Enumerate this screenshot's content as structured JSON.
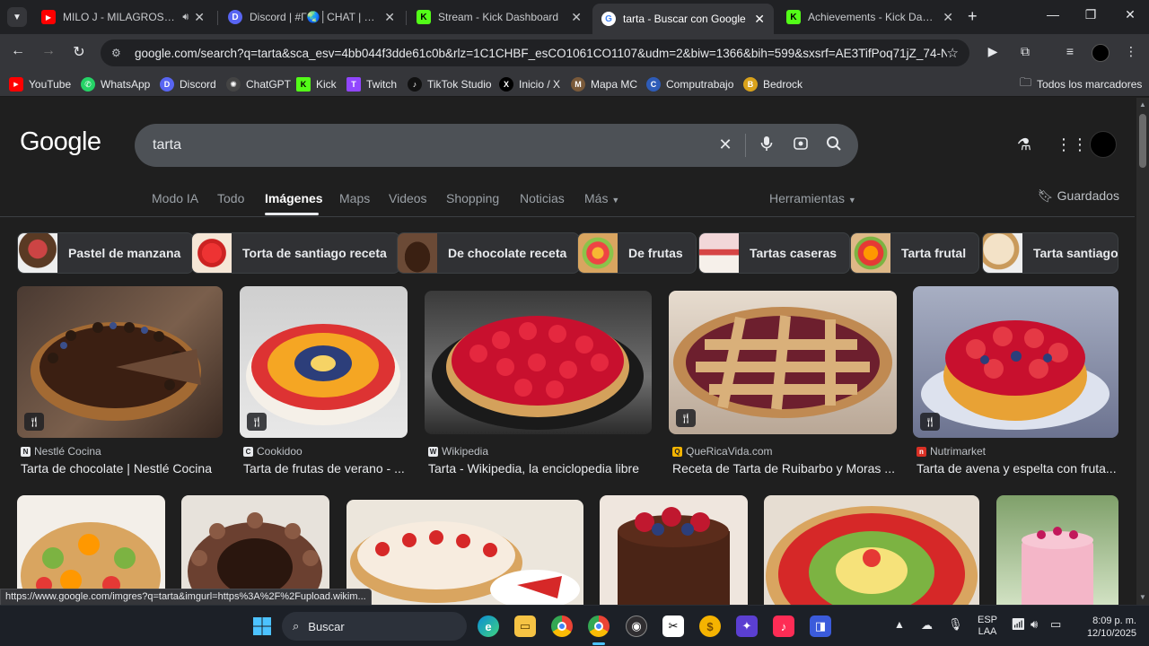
{
  "tabs": [
    {
      "label": "MILO J - MILAGROSA (V",
      "favicon_color": "#ff0000",
      "favicon_glyph": "▶",
      "icon": "youtube-icon",
      "audio": true
    },
    {
      "label": "Discord | #Γ🌏│CHAT | CATADO",
      "favicon_color": "#5865f2",
      "favicon_glyph": "D",
      "icon": "discord-icon"
    },
    {
      "label": "Stream - Kick Dashboard",
      "favicon_color": "#53fc18",
      "favicon_glyph": "K",
      "icon": "kick-icon"
    },
    {
      "label": "tarta - Buscar con Google",
      "favicon_color": "#ffffff",
      "favicon_glyph": "G",
      "icon": "google-icon",
      "active": true
    },
    {
      "label": "Achievements - Kick Dashbo",
      "favicon_color": "#53fc18",
      "favicon_glyph": "K",
      "icon": "kick-icon"
    }
  ],
  "toolbar": {
    "url": "google.com/search?q=tarta&sca_esv=4bb044f3dde61c0b&rlz=1C1CHBF_esCO1061CO1107&udm=2&biw=1366&bih=599&sxsrf=AE3TifPoq71jZ_74-NU..."
  },
  "bookmarks": [
    {
      "label": "YouTube",
      "color": "#ff0000",
      "glyph": "▶"
    },
    {
      "label": "WhatsApp",
      "color": "#25d366",
      "glyph": "✆"
    },
    {
      "label": "Discord",
      "color": "#5865f2",
      "glyph": "D"
    },
    {
      "label": "ChatGPT",
      "color": "#444",
      "glyph": "✺"
    },
    {
      "label": "Kick",
      "color": "#53fc18",
      "glyph": "K"
    },
    {
      "label": "Twitch",
      "color": "#9146ff",
      "glyph": "T"
    },
    {
      "label": "TikTok Studio",
      "color": "#111",
      "glyph": "♪"
    },
    {
      "label": "Inicio / X",
      "color": "#000",
      "glyph": "X"
    },
    {
      "label": "Mapa MC",
      "color": "#7a5a3a",
      "glyph": "M"
    },
    {
      "label": "Computrabajo",
      "color": "#2e5cb8",
      "glyph": "C"
    },
    {
      "label": "Bedrock",
      "color": "#d9a21b",
      "glyph": "B"
    }
  ],
  "all_bookmarks": "Todos los marcadores",
  "search": {
    "query": "tarta",
    "logo": "Google"
  },
  "nav": [
    "Modo IA",
    "Todo",
    "Imágenes",
    "Maps",
    "Videos",
    "Shopping",
    "Noticias",
    "Más",
    "Herramientas"
  ],
  "saved": "Guardados",
  "chips": [
    "Pastel de manzana",
    "Torta de santiago receta",
    "De chocolate receta",
    "De frutas",
    "Tartas caseras",
    "Tarta frutal",
    "Tarta santiago"
  ],
  "results": [
    {
      "source": "Nestlé Cocina",
      "title": "Tarta de chocolate | Nestlé Cocina",
      "source_color": "#e8eaed"
    },
    {
      "source": "Cookidoo",
      "title": "Tarta de frutas de verano - ...",
      "source_color": "#e8eaed"
    },
    {
      "source": "Wikipedia",
      "title": "Tarta - Wikipedia, la enciclopedia libre",
      "source_color": "#e8eaed"
    },
    {
      "source": "QueRicaVida.com",
      "title": "Receta de Tarta de Ruibarbo y Moras ...",
      "source_color": "#f4b400"
    },
    {
      "source": "Nutrimarket",
      "title": "Tarta de avena y espelta con fruta...",
      "source_color": "#d93025"
    }
  ],
  "status_url": "https://www.google.com/imgres?q=tarta&imgurl=https%3A%2F%2Fupload.wikim...",
  "taskbar": {
    "search_placeholder": "Buscar",
    "lang": "ESP",
    "region": "LAA",
    "time": "8:09 p. m.",
    "date": "12/10/2025"
  }
}
